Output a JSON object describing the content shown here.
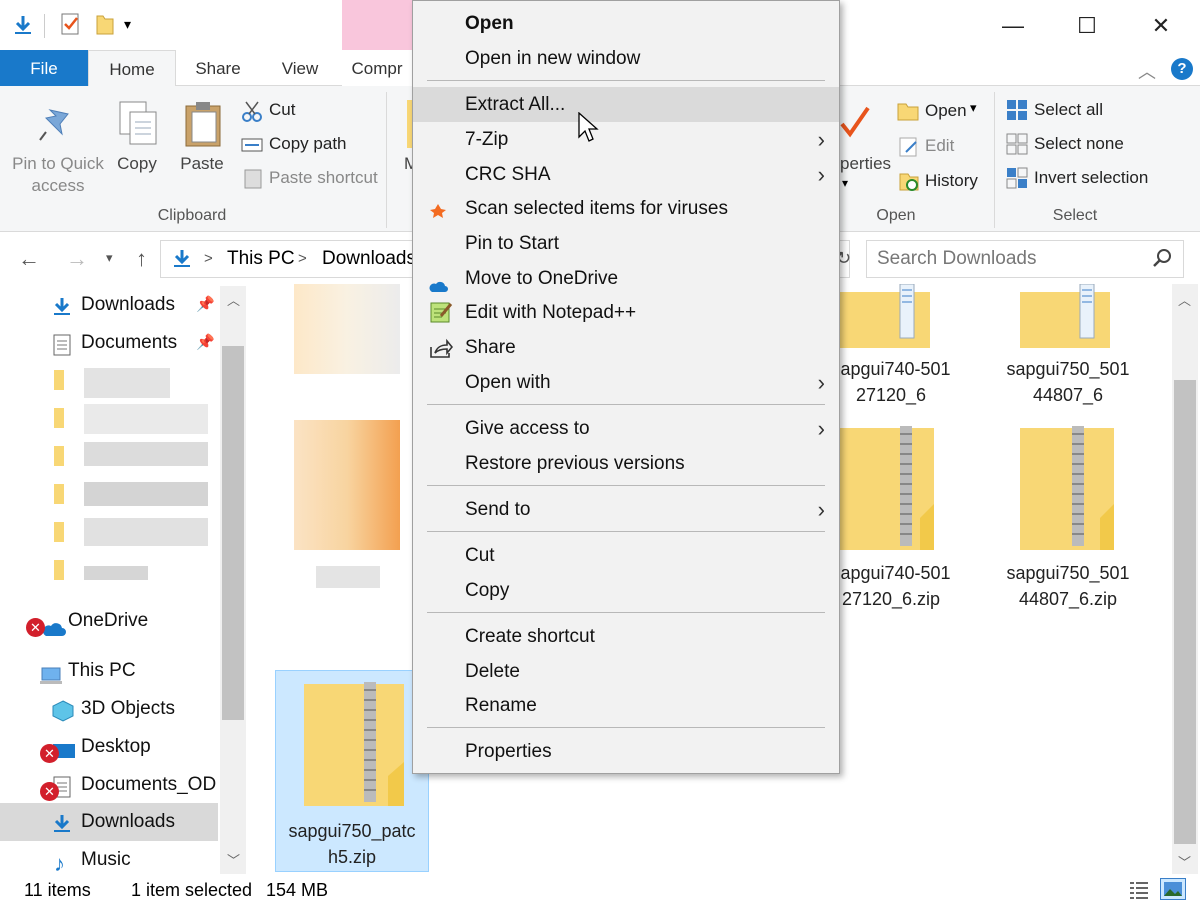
{
  "titlebar": {
    "tool_label": "Compr",
    "window_buttons": [
      "—",
      "☐",
      "✕"
    ]
  },
  "tabs": [
    {
      "label": "File"
    },
    {
      "label": "Home"
    },
    {
      "label": "Share"
    },
    {
      "label": "View"
    }
  ],
  "ribbon": {
    "pin_label": "Pin to Quick access",
    "copy_label": "Copy",
    "paste_label": "Paste",
    "cut_label": "Cut",
    "copy_path_label": "Copy path",
    "paste_shortcut_label": "Paste shortcut",
    "clipboard_group": "Clipboard",
    "move_label": "M",
    "properties_label": "perties",
    "open_label": "Open",
    "edit_label": "Edit",
    "history_label": "History",
    "open_group": "Open",
    "select_all_label": "Select all",
    "select_none_label": "Select none",
    "invert_selection_label": "Invert selection",
    "select_group": "Select"
  },
  "nav": {
    "breadcrumb_root": "This PC",
    "breadcrumb_current": "Downloads",
    "search_placeholder": "Search Downloads"
  },
  "sidebar": {
    "quick_items": [
      {
        "label": "Downloads"
      },
      {
        "label": "Documents"
      }
    ],
    "onedrive": "OneDrive",
    "this_pc": "This PC",
    "pc_items": [
      {
        "label": "3D Objects"
      },
      {
        "label": "Desktop"
      },
      {
        "label": "Documents_OD"
      },
      {
        "label": "Downloads"
      },
      {
        "label": "Music"
      }
    ]
  },
  "files": [
    {
      "name_line1": "sapgui740-501",
      "name_line2": "27120_6"
    },
    {
      "name_line1": "sapgui750_501",
      "name_line2": "44807_6"
    },
    {
      "name_line1": "sapgui740-501",
      "name_line2": "27120_6.zip"
    },
    {
      "name_line1": "sapgui750_501",
      "name_line2": "44807_6.zip"
    },
    {
      "name_line1": "sapgui750_patc",
      "name_line2": "h5.zip"
    }
  ],
  "context_menu": {
    "items": [
      {
        "label": "Open"
      },
      {
        "label": "Open in new window"
      },
      {
        "label": "Extract All..."
      },
      {
        "label": "7-Zip"
      },
      {
        "label": "CRC SHA"
      },
      {
        "label": "Scan selected items for viruses"
      },
      {
        "label": "Pin to Start"
      },
      {
        "label": "Move to OneDrive"
      },
      {
        "label": "Edit with Notepad++"
      },
      {
        "label": "Share"
      },
      {
        "label": "Open with"
      },
      {
        "label": "Give access to"
      },
      {
        "label": "Restore previous versions"
      },
      {
        "label": "Send to"
      },
      {
        "label": "Cut"
      },
      {
        "label": "Copy"
      },
      {
        "label": "Create shortcut"
      },
      {
        "label": "Delete"
      },
      {
        "label": "Rename"
      },
      {
        "label": "Properties"
      }
    ]
  },
  "status": {
    "item_count": "11 items",
    "selection": "1 item selected",
    "size": "154 MB"
  },
  "colors": {
    "file_tab": "#1979ca",
    "selection": "#cce8ff",
    "menu_bg": "#f2f2f2",
    "folder": "#f8d775"
  }
}
